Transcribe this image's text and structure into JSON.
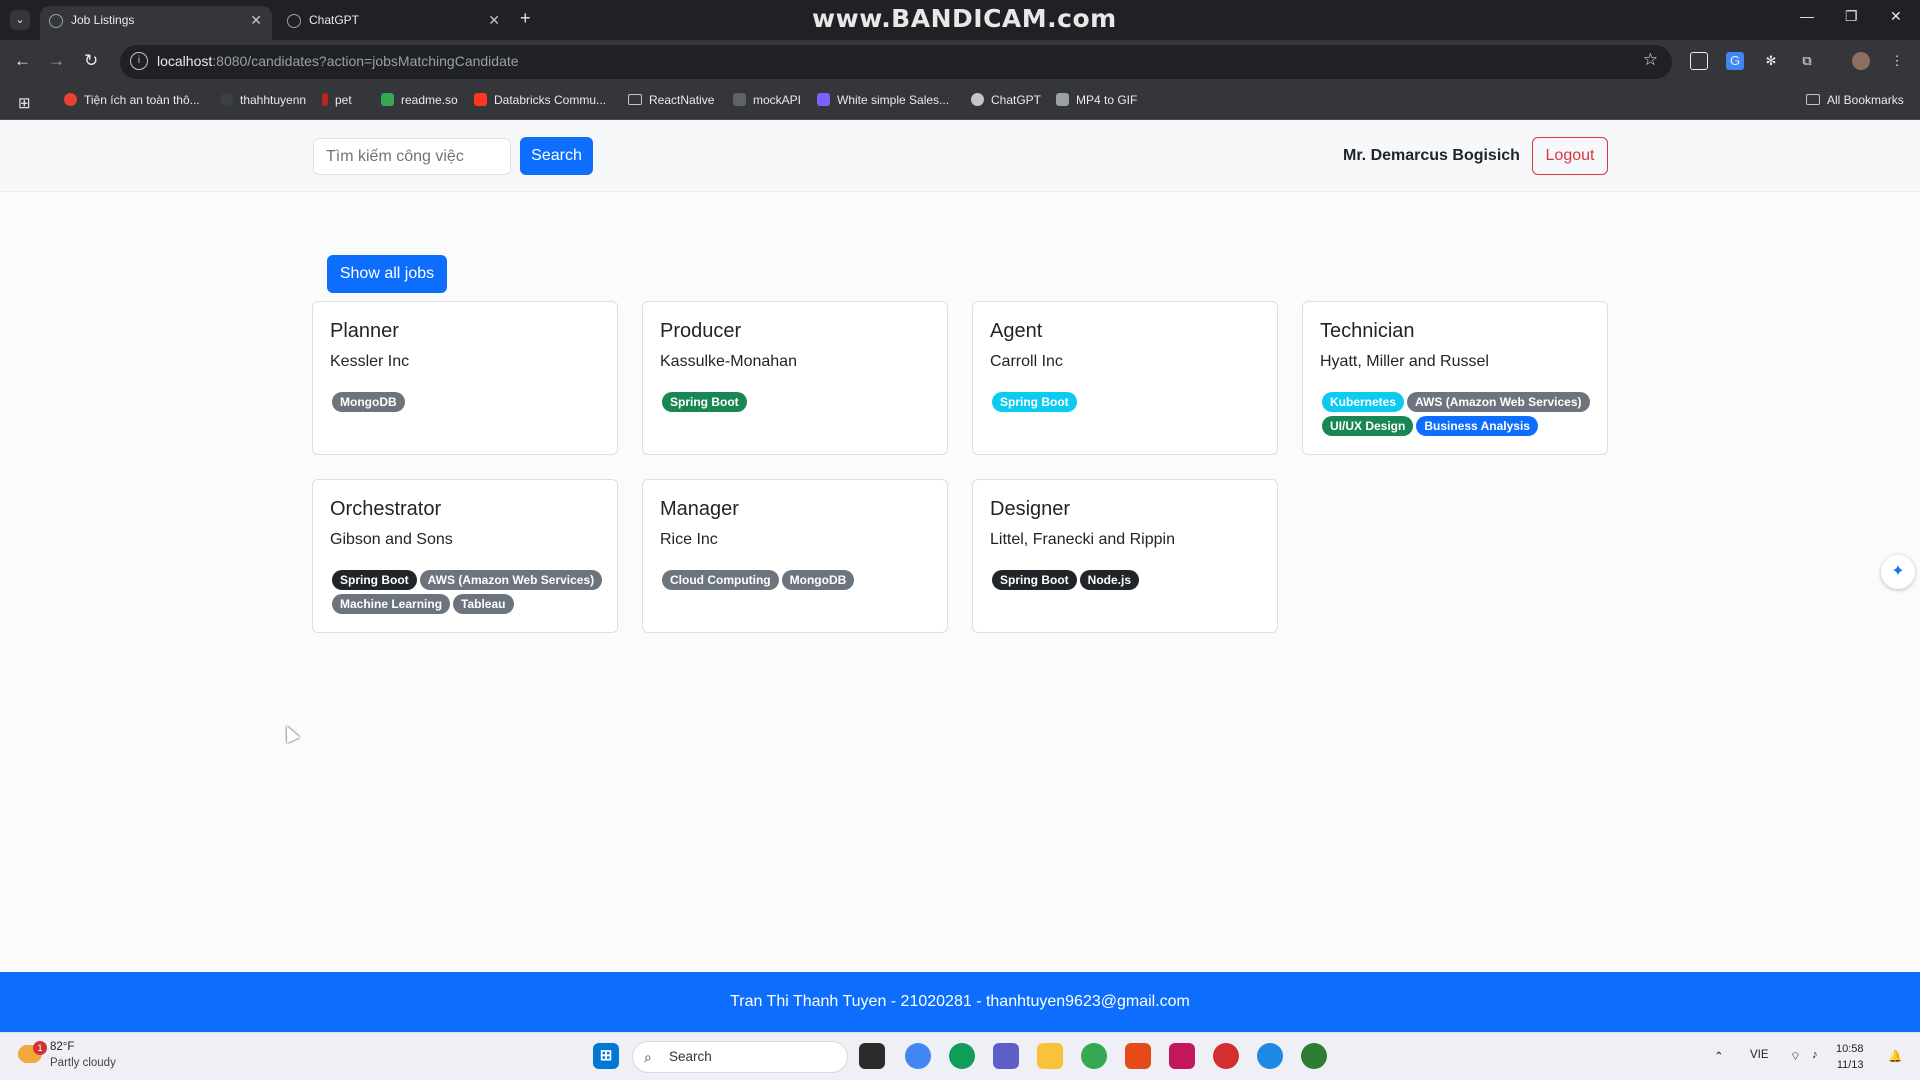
{
  "browser": {
    "tabs": [
      {
        "label": "Job Listings",
        "active": true
      },
      {
        "label": "ChatGPT",
        "active": false
      }
    ],
    "watermark": "www.BANDICAM.com",
    "url_host": "localhost",
    "url_rest": ":8080/candidates?action=jobsMatchingCandidate",
    "bookmarks": [
      {
        "label": "Tiện ích an toàn thô...",
        "color": "#e94235"
      },
      {
        "label": "thahhtuyenn",
        "color": "#3c4043"
      },
      {
        "label": "pet",
        "color": "#c5221f"
      },
      {
        "label": "readme.so",
        "color": "#34a853"
      },
      {
        "label": "Databricks Commu...",
        "color": "#ff3621"
      },
      {
        "label": "ReactNative",
        "color": "folder"
      },
      {
        "label": "mockAPI",
        "color": "#5f6368"
      },
      {
        "label": "White simple Sales...",
        "color": "#7b61ff"
      },
      {
        "label": "ChatGPT",
        "color": "#c4c7c5"
      },
      {
        "label": "MP4 to GIF",
        "color": "#9aa0a6"
      }
    ],
    "all_bookmarks": "All Bookmarks"
  },
  "navbar": {
    "search_placeholder": "Tìm kiếm công việc",
    "search_button": "Search",
    "user_name": "Mr. Demarcus Bogisich",
    "logout": "Logout"
  },
  "main": {
    "show_all_jobs": "Show all jobs",
    "jobs": [
      {
        "title": "Planner",
        "company": "Kessler Inc",
        "skills": [
          {
            "name": "MongoDB",
            "color": "#6c757d"
          }
        ]
      },
      {
        "title": "Producer",
        "company": "Kassulke-Monahan",
        "skills": [
          {
            "name": "Spring Boot",
            "color": "#198754"
          }
        ]
      },
      {
        "title": "Agent",
        "company": "Carroll Inc",
        "skills": [
          {
            "name": "Spring Boot",
            "color": "#0dcaf0"
          }
        ]
      },
      {
        "title": "Technician",
        "company": "Hyatt, Miller and Russel",
        "skills": [
          {
            "name": "Kubernetes",
            "color": "#0dcaf0"
          },
          {
            "name": "AWS (Amazon Web Services)",
            "color": "#6c757d"
          },
          {
            "name": "UI/UX Design",
            "color": "#198754"
          },
          {
            "name": "Business Analysis",
            "color": "#0d6efd"
          }
        ]
      },
      {
        "title": "Orchestrator",
        "company": "Gibson and Sons",
        "skills": [
          {
            "name": "Spring Boot",
            "color": "#212529"
          },
          {
            "name": "AWS (Amazon Web Services)",
            "color": "#6c757d"
          },
          {
            "name": "Machine Learning",
            "color": "#6c757d"
          },
          {
            "name": "Tableau",
            "color": "#6c757d"
          }
        ]
      },
      {
        "title": "Manager",
        "company": "Rice Inc",
        "skills": [
          {
            "name": "Cloud Computing",
            "color": "#6c757d"
          },
          {
            "name": "MongoDB",
            "color": "#6c757d"
          }
        ]
      },
      {
        "title": "Designer",
        "company": "Littel, Franecki and Rippin",
        "skills": [
          {
            "name": "Spring Boot",
            "color": "#212529"
          },
          {
            "name": "Node.js",
            "color": "#212529"
          }
        ]
      }
    ]
  },
  "footer": {
    "text": "Tran Thi Thanh Tuyen - 21020281 - thanhtuyen9623@gmail.com"
  },
  "taskbar": {
    "weather_alert": "1",
    "temperature": "82°F",
    "condition": "Partly cloudy",
    "search_label": "Search",
    "language": "VIE",
    "time": "10:58",
    "date": "11/13"
  }
}
